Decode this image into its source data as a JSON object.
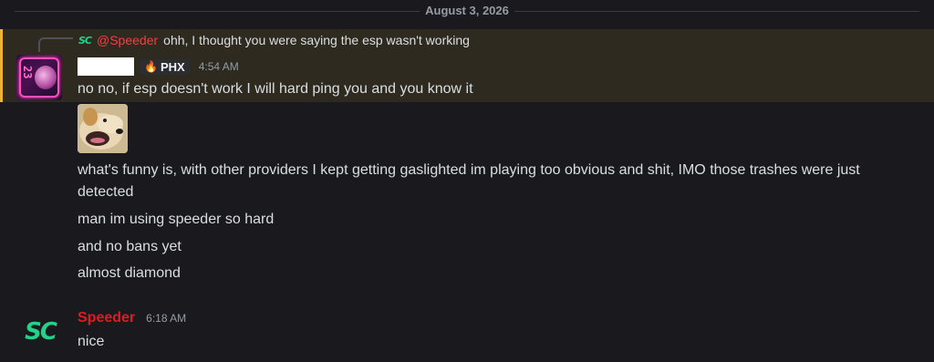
{
  "date_divider": "August 3, 2026",
  "reply": {
    "icon": "sc-logo-icon",
    "mention": "@Speeder",
    "text": "ohh, I thought you were saying the esp wasn't working"
  },
  "message1": {
    "avatar": "cyberpunk-avatar",
    "badge_emoji": "🔥",
    "badge_tag": "PHX",
    "timestamp": "4:54 AM",
    "text": "no no, if esp doesn't work I will hard ping you and you know it"
  },
  "followups": {
    "image": "dog-image",
    "line1": "what's funny is, with other providers I kept getting gaslighted im playing too obvious and shit, IMO those trashes were just detected",
    "line2": "man im using speeder so hard",
    "line3": "and no bans yet",
    "line4": "almost diamond"
  },
  "message2": {
    "avatar_text": "SC",
    "author": "Speeder",
    "timestamp": "6:18 AM",
    "text": "nice"
  },
  "colors": {
    "background": "#1a1a1e",
    "mention_highlight": "#2e2a20",
    "mention_border": "#f0b232",
    "speeder_name": "#e01b24",
    "sc_green": "#23d18b"
  }
}
